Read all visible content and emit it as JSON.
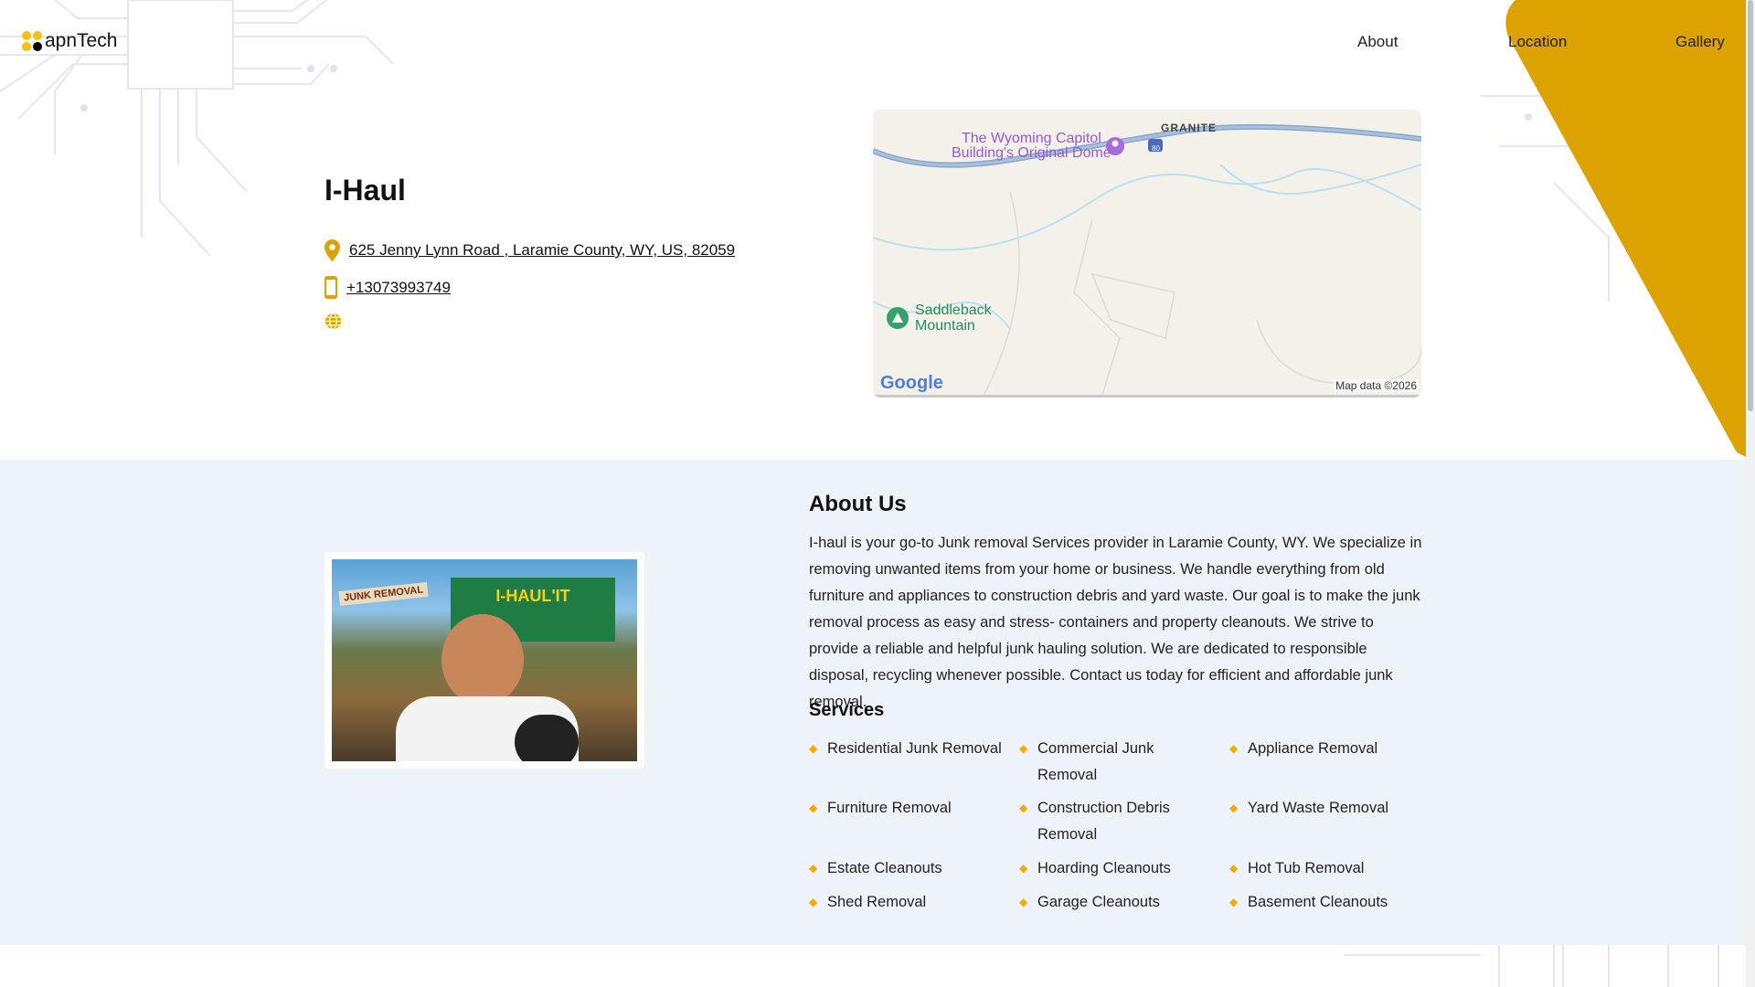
{
  "header": {
    "logo": "apnTech",
    "nav": [
      "About",
      "Location",
      "Gallery"
    ]
  },
  "business": {
    "name": "I-Haul",
    "address": "625 Jenny Lynn Road , Laramie County, WY, US, 82059",
    "phone": "+13073993749"
  },
  "map": {
    "labels": [
      "The Wyoming Capitol",
      "Building's Original Dome",
      "GRANITE",
      "Saddleback",
      "Mountain",
      "80"
    ],
    "google": "Google",
    "attribution": "Map data ©2026"
  },
  "image": {
    "sign": "JUNK REMOVAL",
    "truck": "I-HAUL'IT"
  },
  "about": {
    "heading": "About Us",
    "text": "I-haul is your go-to Junk removal Services provider in Laramie County, WY. We specialize in removing unwanted items from your home or business. We handle everything from old furniture and appliances to construction debris and yard waste. Our goal is to make the junk removal process as easy and stress- containers and property cleanouts. We strive to provide a reliable and helpful junk hauling solution. We are dedicated to responsible disposal, recycling whenever possible. Contact us today for efficient and affordable junk removal."
  },
  "services": {
    "heading": "Services",
    "items": [
      "Residential Junk Removal",
      "Commercial Junk Removal",
      "Appliance Removal",
      "Furniture Removal",
      "Construction Debris Removal",
      "Yard Waste Removal",
      "Estate Cleanouts",
      "Hoarding Cleanouts",
      "Hot Tub Removal",
      "Shed Removal",
      "Garage Cleanouts",
      "Basement Cleanouts"
    ]
  },
  "colors": {
    "accent": "#dba200",
    "section_bg": "#eef3f9"
  }
}
